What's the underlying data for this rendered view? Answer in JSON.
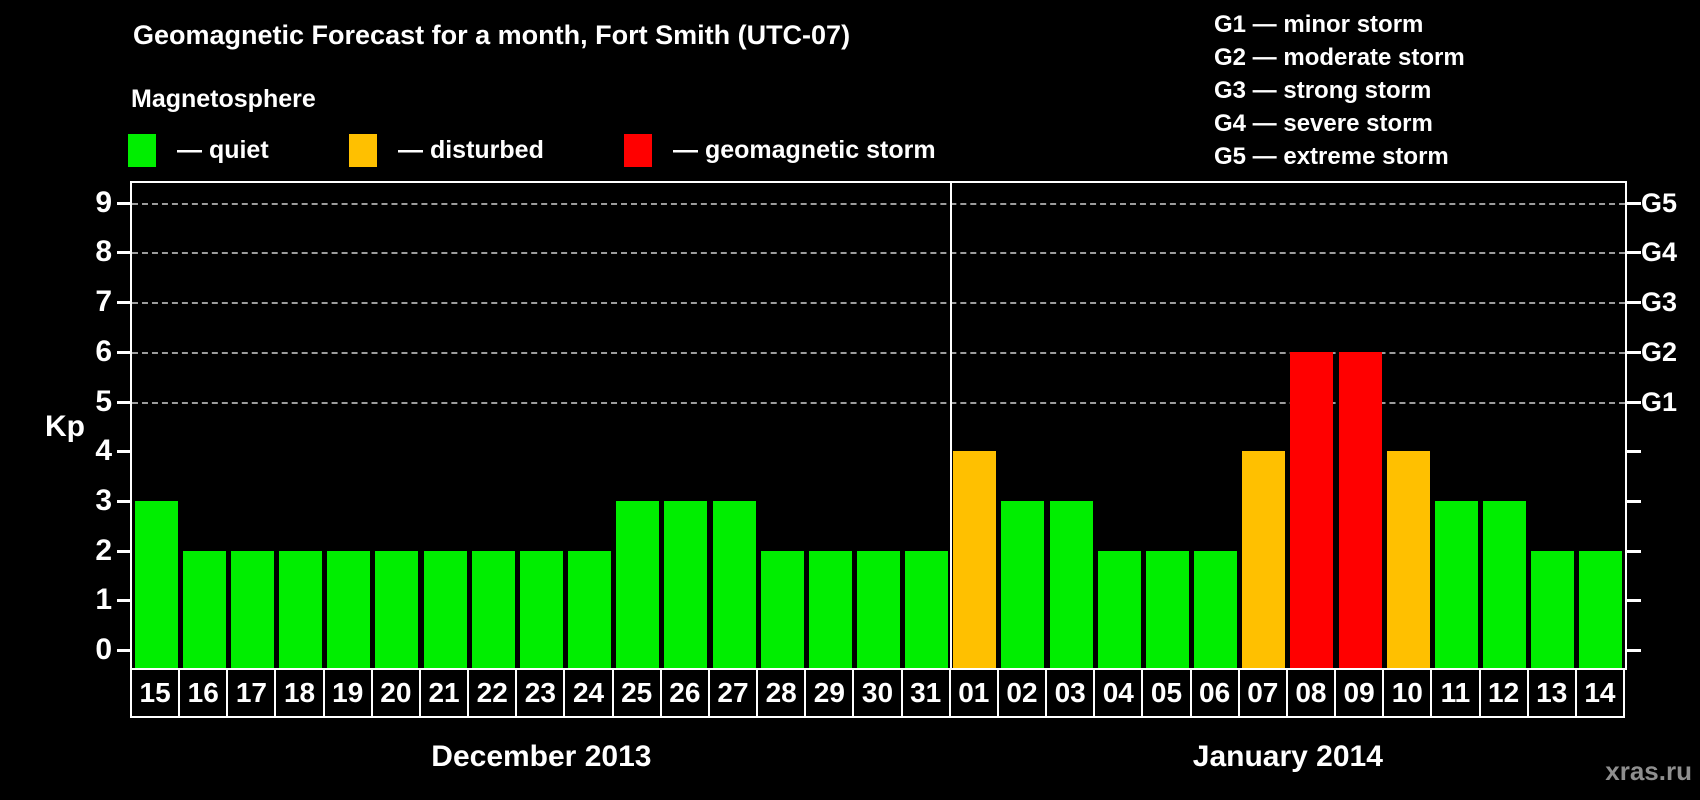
{
  "title": "Geomagnetic Forecast for a month, Fort Smith (UTC-07)",
  "legend": {
    "heading": "Magnetosphere",
    "items": [
      {
        "name": "quiet",
        "label": "— quiet",
        "color": "#00ee00"
      },
      {
        "name": "disturbed",
        "label": "— disturbed",
        "color": "#ffc000"
      },
      {
        "name": "storm",
        "label": "— geomagnetic storm",
        "color": "#ff0000"
      }
    ]
  },
  "g_scale_legend": [
    "G1 — minor storm",
    "G2 — moderate storm",
    "G3 — strong storm",
    "G4 — severe storm",
    "G5 — extreme storm"
  ],
  "y_axis": {
    "label": "Kp",
    "ticks": [
      0,
      1,
      2,
      3,
      4,
      5,
      6,
      7,
      8,
      9
    ]
  },
  "right_axis": [
    {
      "kp": 9,
      "label": "G5"
    },
    {
      "kp": 8,
      "label": "G4"
    },
    {
      "kp": 7,
      "label": "G3"
    },
    {
      "kp": 6,
      "label": "G2"
    },
    {
      "kp": 5,
      "label": "G1"
    }
  ],
  "watermark": "xras.ru",
  "chart_data": {
    "type": "bar",
    "title": "Geomagnetic Forecast for a month, Fort Smith (UTC-07)",
    "xlabel": "",
    "ylabel": "Kp",
    "ylim": [
      0,
      9
    ],
    "grid_kp": [
      5,
      6,
      7,
      8,
      9
    ],
    "legend_position": "top",
    "status_colors": {
      "quiet": "#00ee00",
      "disturbed": "#ffc000",
      "storm": "#ff0000"
    },
    "months": [
      {
        "label": "December 2013",
        "days": [
          "15",
          "16",
          "17",
          "18",
          "19",
          "20",
          "21",
          "22",
          "23",
          "24",
          "25",
          "26",
          "27",
          "28",
          "29",
          "30",
          "31"
        ],
        "values": [
          3,
          2,
          2,
          2,
          2,
          2,
          2,
          2,
          2,
          2,
          3,
          3,
          3,
          2,
          2,
          2,
          2
        ],
        "status": [
          "quiet",
          "quiet",
          "quiet",
          "quiet",
          "quiet",
          "quiet",
          "quiet",
          "quiet",
          "quiet",
          "quiet",
          "quiet",
          "quiet",
          "quiet",
          "quiet",
          "quiet",
          "quiet",
          "quiet"
        ]
      },
      {
        "label": "January 2014",
        "days": [
          "01",
          "02",
          "03",
          "04",
          "05",
          "06",
          "07",
          "08",
          "09",
          "10",
          "11",
          "12",
          "13",
          "14"
        ],
        "values": [
          4,
          3,
          3,
          2,
          2,
          2,
          4,
          6,
          6,
          4,
          3,
          3,
          2,
          2
        ],
        "status": [
          "disturbed",
          "quiet",
          "quiet",
          "quiet",
          "quiet",
          "quiet",
          "disturbed",
          "storm",
          "storm",
          "disturbed",
          "quiet",
          "quiet",
          "quiet",
          "quiet"
        ]
      }
    ]
  }
}
